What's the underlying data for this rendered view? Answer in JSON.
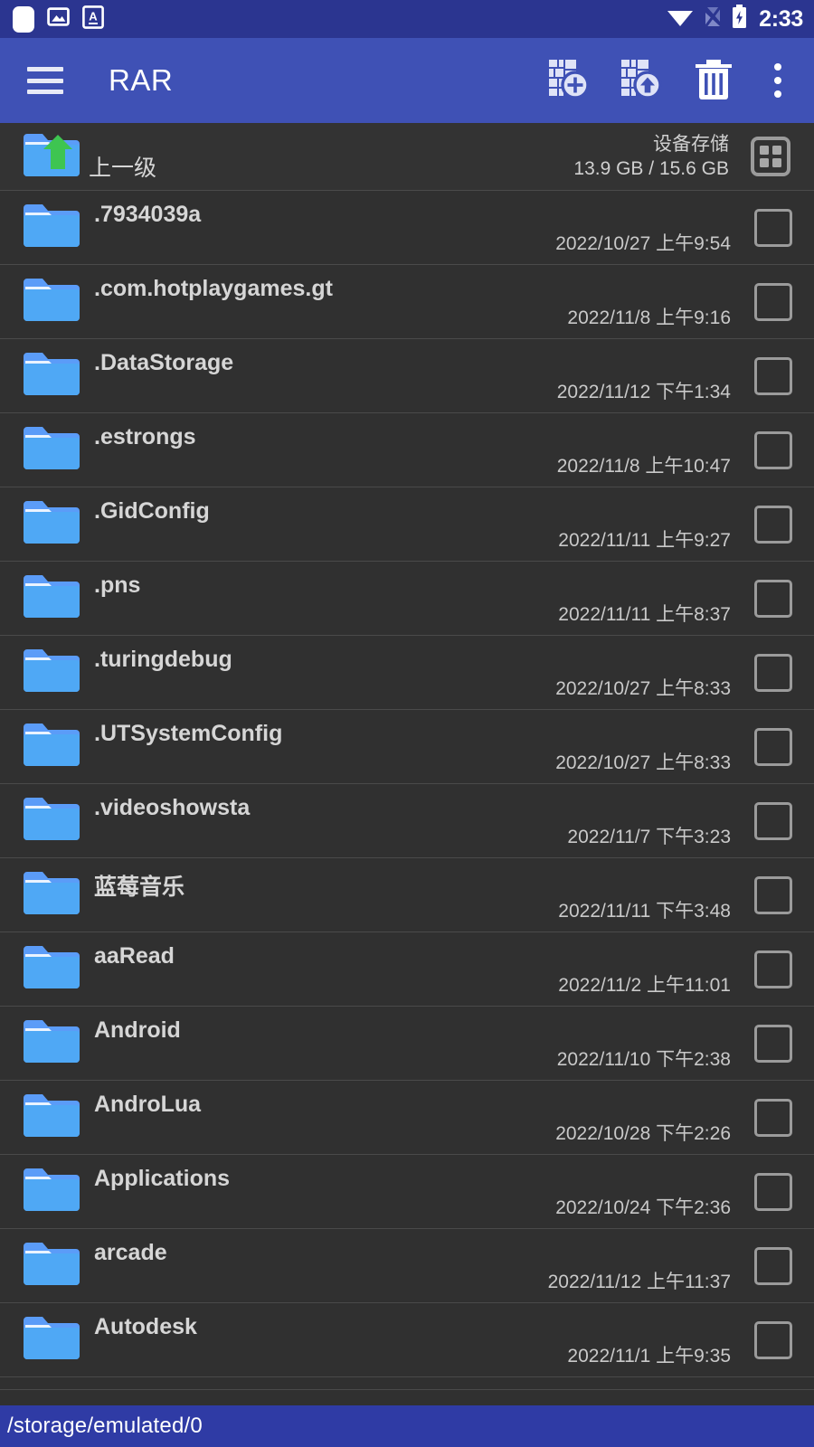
{
  "status_bar": {
    "notification_icons": [
      "rounded-square-icon",
      "image-icon",
      "letter-a-icon"
    ],
    "wifi_icon": "wifi-icon",
    "signal_icon": "no-signal-icon",
    "battery_icon": "battery-charging-icon",
    "time": "2:33",
    "background_color": "#2b3590"
  },
  "app_bar": {
    "menu_label": "menu-icon",
    "title": "RAR",
    "background_color": "#3f51b5",
    "actions": [
      {
        "name": "add-to-archive-button",
        "icon": "archive-add-icon"
      },
      {
        "name": "extract-archive-button",
        "icon": "archive-extract-icon"
      },
      {
        "name": "delete-button",
        "icon": "trash-icon"
      },
      {
        "name": "overflow-menu-button",
        "icon": "more-vertical-icon"
      }
    ]
  },
  "header_row": {
    "parent_label": "上一级",
    "storage_title": "设备存储",
    "storage_usage": "13.9 GB / 15.6 GB",
    "view_toggle_icon": "grid-view-icon"
  },
  "file_list": {
    "items": [
      {
        "name": ".7934039a",
        "date": "2022/10/27 上午9:54",
        "checked": false
      },
      {
        "name": ".com.hotplaygames.gt",
        "date": "2022/11/8 上午9:16",
        "checked": false
      },
      {
        "name": ".DataStorage",
        "date": "2022/11/12 下午1:34",
        "checked": false
      },
      {
        "name": ".estrongs",
        "date": "2022/11/8 上午10:47",
        "checked": false
      },
      {
        "name": ".GidConfig",
        "date": "2022/11/11 上午9:27",
        "checked": false
      },
      {
        "name": ".pns",
        "date": "2022/11/11 上午8:37",
        "checked": false
      },
      {
        "name": ".turingdebug",
        "date": "2022/10/27 上午8:33",
        "checked": false
      },
      {
        "name": ".UTSystemConfig",
        "date": "2022/10/27 上午8:33",
        "checked": false
      },
      {
        "name": ".videoshowsta",
        "date": "2022/11/7 下午3:23",
        "checked": false
      },
      {
        "name": "蓝莓音乐",
        "date": "2022/11/11 下午3:48",
        "checked": false
      },
      {
        "name": "aaRead",
        "date": "2022/11/2 上午11:01",
        "checked": false
      },
      {
        "name": "Android",
        "date": "2022/11/10 下午2:38",
        "checked": false
      },
      {
        "name": "AndroLua",
        "date": "2022/10/28 下午2:26",
        "checked": false
      },
      {
        "name": "Applications",
        "date": "2022/10/24 下午2:36",
        "checked": false
      },
      {
        "name": "arcade",
        "date": "2022/11/12 上午11:37",
        "checked": false
      },
      {
        "name": "Autodesk",
        "date": "2022/11/1 上午9:35",
        "checked": false
      }
    ]
  },
  "path_bar": {
    "path": "/storage/emulated/0",
    "background_color": "#2f3ba5"
  },
  "theme": {
    "list_background": "#303030",
    "divider": "#4a4a4a",
    "folder_blue": "#4fa8f5",
    "accent_green": "#3ec551"
  }
}
